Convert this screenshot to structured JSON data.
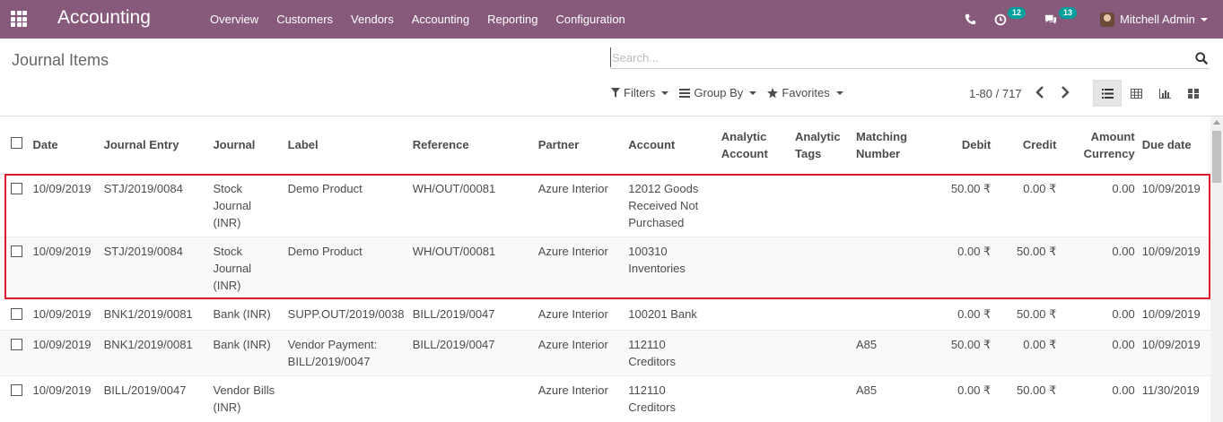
{
  "app": {
    "title": "Accounting"
  },
  "nav": {
    "menu": [
      "Overview",
      "Customers",
      "Vendors",
      "Accounting",
      "Reporting",
      "Configuration"
    ],
    "activity_count": "12",
    "message_count": "13",
    "user_name": "Mitchell Admin"
  },
  "control_panel": {
    "breadcrumb": "Journal Items",
    "search_placeholder": "Search...",
    "filters_label": "Filters",
    "group_by_label": "Group By",
    "favorites_label": "Favorites",
    "pager": "1-80 / 717"
  },
  "table": {
    "headers": {
      "date": "Date",
      "journal_entry": "Journal Entry",
      "journal": "Journal",
      "label": "Label",
      "reference": "Reference",
      "partner": "Partner",
      "account": "Account",
      "analytic_account": "Analytic Account",
      "analytic_tags": "Analytic Tags",
      "matching_number": "Matching Number",
      "debit": "Debit",
      "credit": "Credit",
      "amount_currency": "Amount Currency",
      "due_date": "Due date"
    },
    "rows": [
      {
        "date": "10/09/2019",
        "journal_entry": "STJ/2019/0084",
        "journal": "Stock Journal (INR)",
        "label": "Demo Product",
        "reference": "WH/OUT/00081",
        "partner": "Azure Interior",
        "account": "12012 Goods Received Not Purchased",
        "analytic_account": "",
        "analytic_tags": "",
        "matching_number": "",
        "debit": "50.00 ₹",
        "credit": "0.00 ₹",
        "amount_currency": "0.00",
        "due_date": "10/09/2019"
      },
      {
        "date": "10/09/2019",
        "journal_entry": "STJ/2019/0084",
        "journal": "Stock Journal (INR)",
        "label": "Demo Product",
        "reference": "WH/OUT/00081",
        "partner": "Azure Interior",
        "account": "100310 Inventories",
        "analytic_account": "",
        "analytic_tags": "",
        "matching_number": "",
        "debit": "0.00 ₹",
        "credit": "50.00 ₹",
        "amount_currency": "0.00",
        "due_date": "10/09/2019"
      },
      {
        "date": "10/09/2019",
        "journal_entry": "BNK1/2019/0081",
        "journal": "Bank (INR)",
        "label": "SUPP.OUT/2019/0038",
        "reference": "BILL/2019/0047",
        "partner": "Azure Interior",
        "account": "100201 Bank",
        "analytic_account": "",
        "analytic_tags": "",
        "matching_number": "",
        "debit": "0.00 ₹",
        "credit": "50.00 ₹",
        "amount_currency": "0.00",
        "due_date": "10/09/2019"
      },
      {
        "date": "10/09/2019",
        "journal_entry": "BNK1/2019/0081",
        "journal": "Bank (INR)",
        "label": "Vendor Payment: BILL/2019/0047",
        "reference": "BILL/2019/0047",
        "partner": "Azure Interior",
        "account": "112110 Creditors",
        "analytic_account": "",
        "analytic_tags": "",
        "matching_number": "A85",
        "debit": "50.00 ₹",
        "credit": "0.00 ₹",
        "amount_currency": "0.00",
        "due_date": "10/09/2019"
      },
      {
        "date": "10/09/2019",
        "journal_entry": "BILL/2019/0047",
        "journal": "Vendor Bills (INR)",
        "label": "",
        "reference": "",
        "partner": "Azure Interior",
        "account": "112110 Creditors",
        "analytic_account": "",
        "analytic_tags": "",
        "matching_number": "A85",
        "debit": "0.00 ₹",
        "credit": "50.00 ₹",
        "amount_currency": "0.00",
        "due_date": "11/30/2019"
      }
    ]
  },
  "colors": {
    "navbar": "#875a7b",
    "badge": "#00a09d",
    "highlight": "#e1182e"
  }
}
